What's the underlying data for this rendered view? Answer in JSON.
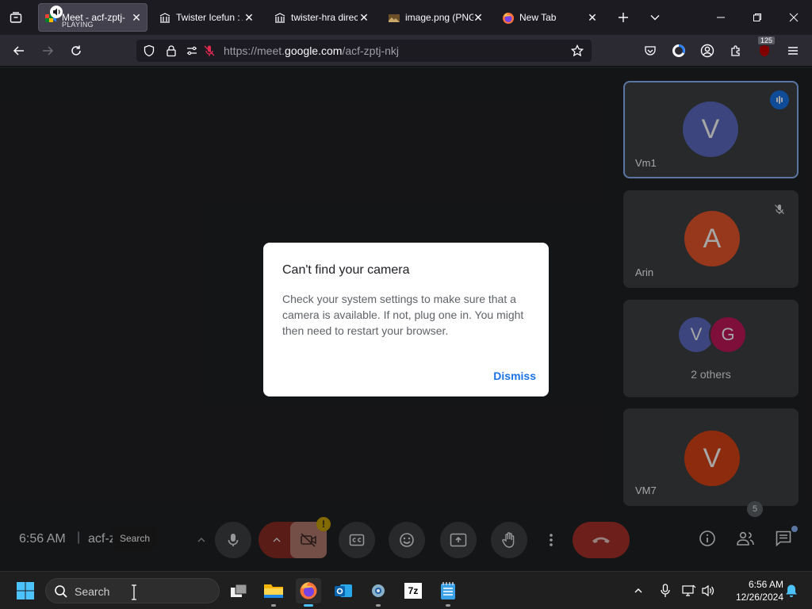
{
  "browser": {
    "tabs": [
      {
        "title": "Meet - acf-zptj-",
        "subtitle": "PLAYING",
        "active": true,
        "favicon": "meet-icon"
      },
      {
        "title": "Twister Icefun : A",
        "active": false,
        "favicon": "archive-icon"
      },
      {
        "title": "twister-hra direc",
        "active": false,
        "favicon": "archive-icon"
      },
      {
        "title": "image.png (PNG",
        "active": false,
        "favicon": "image-icon"
      },
      {
        "title": "New Tab",
        "active": false,
        "favicon": "firefox-icon"
      }
    ],
    "url_prefix": "https://meet.",
    "url_domain": "google.com",
    "url_path": "/acf-zptj-nkj",
    "extensions_badge": "125"
  },
  "meet": {
    "participants": [
      {
        "name": "Vm1",
        "initial": "V",
        "color": "#5c6bc0",
        "speaking": true
      },
      {
        "name": "Arin",
        "initial": "A",
        "color": "#e8552c",
        "muted": true
      },
      {
        "others_label": "2 others",
        "initials": [
          "V",
          "G"
        ],
        "colors": [
          "#5c6bc0",
          "#c2185b"
        ]
      },
      {
        "name": "VM7",
        "initial": "V",
        "color": "#d84315"
      }
    ],
    "dialog": {
      "title": "Can't find your camera",
      "body": "Check your system settings to make sure that a camera is available. If not, plug one in. You might then need to restart your browser.",
      "dismiss": "Dismiss"
    },
    "bottom": {
      "time": "6:56 AM",
      "separator": "|",
      "meeting_code": "acf-zptj-nkj",
      "tooltip": "Search",
      "camera_warning": "!",
      "people_count": "5"
    }
  },
  "taskbar": {
    "search_placeholder": "Search",
    "time": "6:56 AM",
    "date": "12/26/2024",
    "seven_zip": "7z"
  }
}
